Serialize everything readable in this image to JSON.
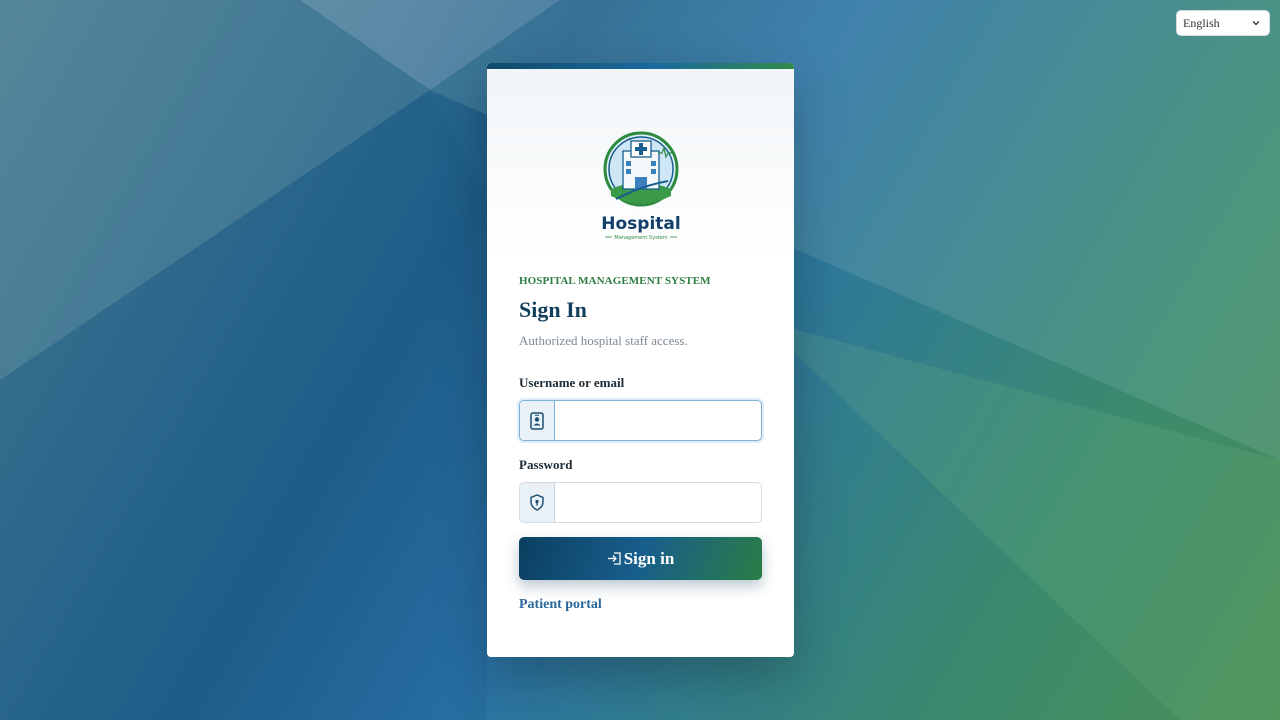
{
  "language": {
    "selected": "English"
  },
  "logo": {
    "name": "Hospital",
    "tagline": "Management System"
  },
  "header": {
    "eyebrow": "HOSPITAL MANAGEMENT SYSTEM",
    "title": "Sign In",
    "subtitle": "Authorized hospital staff access."
  },
  "form": {
    "username_label": "Username or email",
    "username_value": "",
    "password_label": "Password",
    "password_value": "",
    "submit_label": "Sign in"
  },
  "links": {
    "patient_portal": "Patient portal"
  },
  "colors": {
    "primary": "#123f5c",
    "accent_green": "#2e7d42",
    "link": "#2a679a"
  },
  "icons": {
    "username": "id-badge-icon",
    "password": "shield-lock-icon",
    "submit": "sign-in-icon",
    "language": "chevron-down-icon"
  }
}
